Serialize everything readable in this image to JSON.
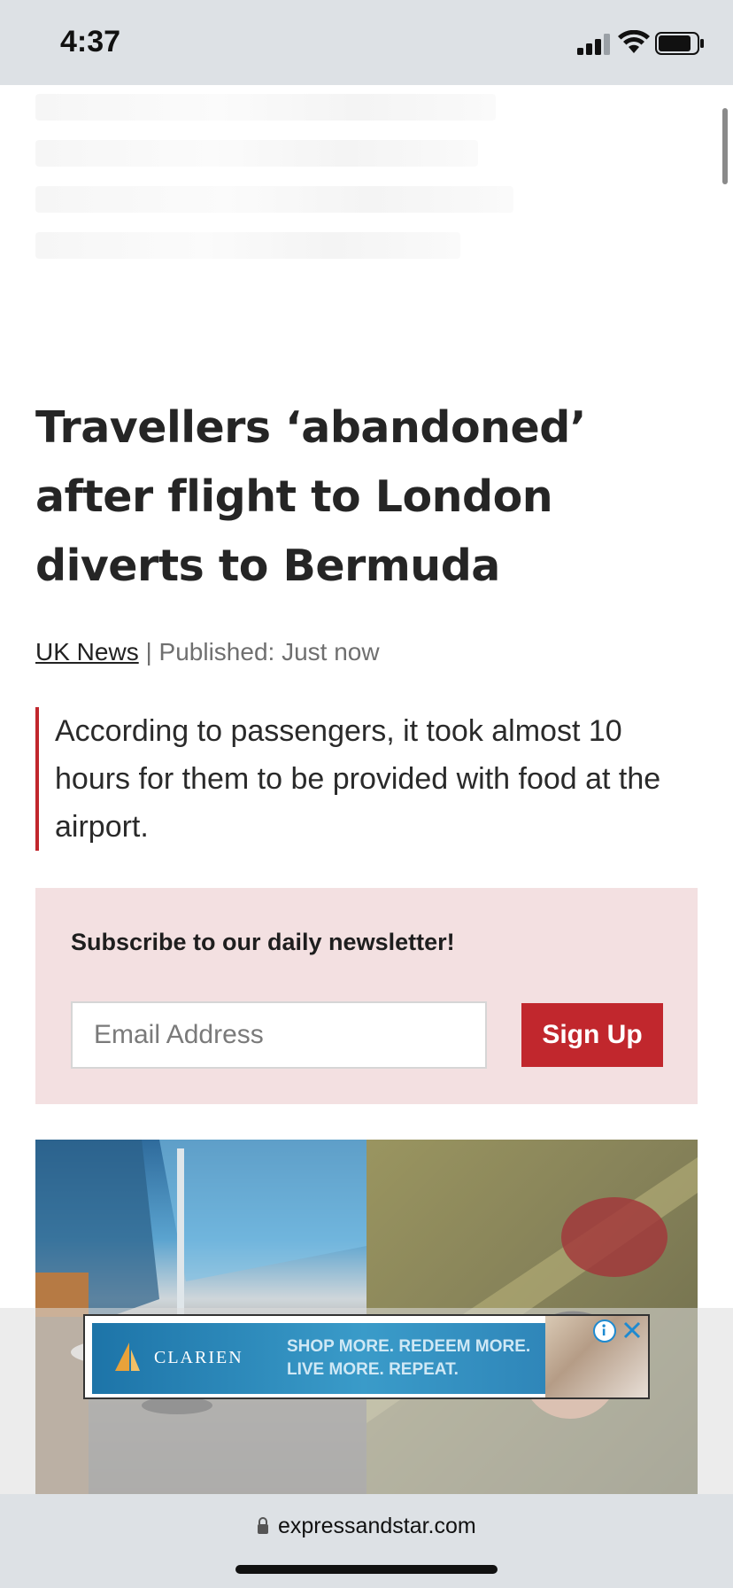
{
  "status_bar": {
    "time": "4:37"
  },
  "article": {
    "headline": "Travellers ‘abandoned’ after flight to London diverts to Bermuda",
    "section": "UK News",
    "published": " | Published: Just now",
    "standfirst": "According to passengers, it took almost 10 hours for them to be provided with food at the airport."
  },
  "newsletter": {
    "title": "Subscribe to our daily newsletter!",
    "email_placeholder": "Email Address",
    "button_label": "Sign Up"
  },
  "ad": {
    "brand": "CLARIEN",
    "line1": "SHOP MORE. REDEEM MORE.",
    "line2": "LIVE MORE. REPEAT."
  },
  "browser": {
    "url": "expressandstar.com"
  },
  "colors": {
    "accent": "#c1272d",
    "newsletter_bg": "#f3e0e1",
    "chrome_bg": "#dde1e5"
  }
}
